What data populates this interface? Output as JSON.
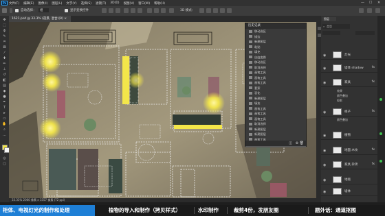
{
  "menu": {
    "app_icon": "Ps",
    "items": [
      "文件(F)",
      "编辑(E)",
      "图像(I)",
      "图层(L)",
      "文字(Y)",
      "选择(S)",
      "滤镜(T)",
      "3D(D)",
      "视图(V)",
      "窗口(W)",
      "帮助(H)"
    ],
    "window_controls": [
      "—",
      "☐",
      "✕"
    ]
  },
  "options": {
    "auto_select_label": "自动选择：",
    "group_label": "组",
    "transform_label": "显示变换控件",
    "mode_3d_label": "3D 模式："
  },
  "document": {
    "tab_title": "1621.psd @ 33.3% (夜景, 混合)(8) ×"
  },
  "status": {
    "text": "33.33%    2000 像素 x 1557 像素 (72 ppi)"
  },
  "history": {
    "title": "历史记录",
    "items": [
      "移动选区",
      "描边",
      "新建图层",
      "粘贴",
      "填充",
      "自由变换",
      "移动选区",
      "取消选择",
      "画笔工具",
      "画笔工具",
      "画笔工具",
      "套索",
      "羽化",
      "新建图层",
      "填充",
      "画笔工具",
      "画笔工具",
      "画笔工具",
      "取消选择",
      "新建图层",
      "新建图层",
      "画笔工具",
      "画笔工具",
      "复制图层",
      "载入选区"
    ],
    "selected_index": 24
  },
  "layers": {
    "search_placeholder": "类型",
    "items": [
      {
        "name": "灯光",
        "fx": ""
      },
      {
        "name": "墙体 shadow",
        "fx": "fx"
      },
      {
        "name": "家具",
        "fx": "fx"
      },
      {
        "name": "柜子",
        "fx": "fx"
      },
      {
        "name": "植物",
        "fx": ""
      },
      {
        "name": "地面 木纹",
        "fx": "fx"
      },
      {
        "name": "家具 杂项",
        "fx": "fx"
      },
      {
        "name": "地毯",
        "fx": ""
      },
      {
        "name": "墙体",
        "fx": ""
      }
    ],
    "effects_sub": [
      "效果",
      "颜色叠加",
      "投影"
    ]
  },
  "subtitles": {
    "line1": "柜体、电视灯光的制作和处理",
    "line2": "植物的导入和制作（拷贝样式）",
    "line3": "水印制作",
    "line4": "裁剪4份，发朋友圈",
    "line5": "题外话：通道抠图"
  },
  "colors": {
    "canvas_bg": "#111111",
    "wall": "#a89c80",
    "highlight": "#f3e64a",
    "subtitle_accent": "#1e7fd6"
  }
}
